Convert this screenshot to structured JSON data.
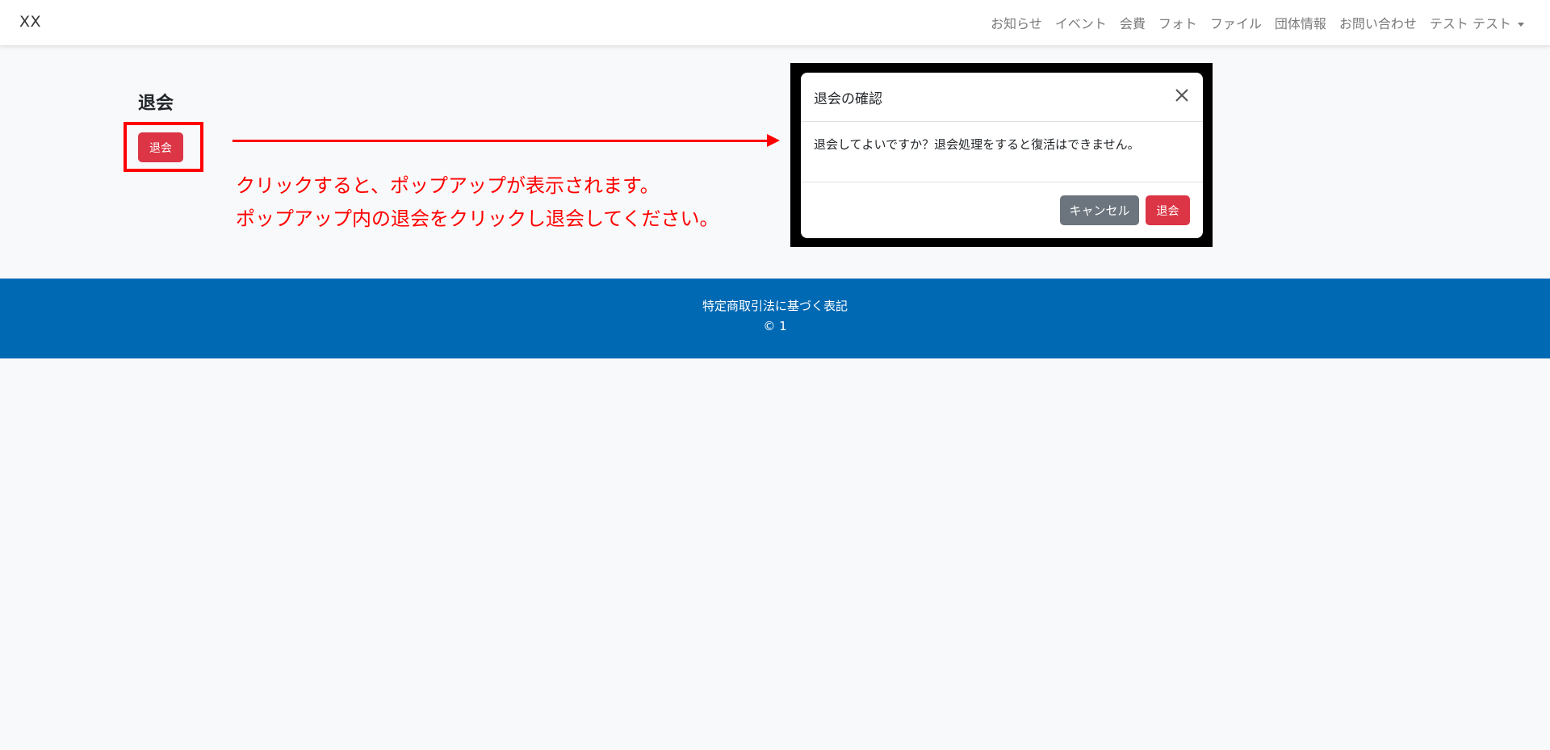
{
  "navbar": {
    "brand": "XX",
    "items": [
      {
        "label": "お知らせ"
      },
      {
        "label": "イベント"
      },
      {
        "label": "会費"
      },
      {
        "label": "フォト"
      },
      {
        "label": "ファイル"
      },
      {
        "label": "団体情報"
      },
      {
        "label": "お問い合わせ"
      },
      {
        "label": "テスト テスト"
      }
    ]
  },
  "page": {
    "title": "退会",
    "withdraw_button": "退会"
  },
  "annotation": {
    "line1": "クリックすると、ポップアップが表示されます。",
    "line2": "ポップアップ内の退会をクリックし退会してください。",
    "color": "#ff0000"
  },
  "modal": {
    "title": "退会の確認",
    "close_icon": "close-icon",
    "body": "退会してよいですか？退会処理をすると復活はできません。",
    "cancel_label": "キャンセル",
    "confirm_label": "退会"
  },
  "footer": {
    "link": "特定商取引法に基づく表記",
    "copyright": "© 1",
    "color": "#0069b4"
  },
  "colors": {
    "danger": "#dc3545",
    "secondary": "#6c757d",
    "background": "#f8f9fa"
  }
}
